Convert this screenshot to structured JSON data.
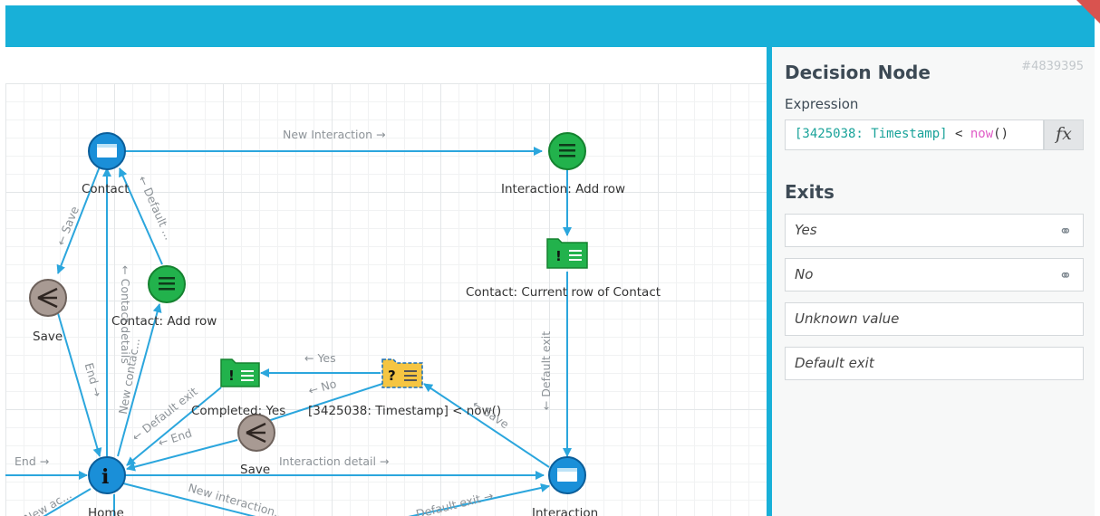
{
  "diagram": {
    "nodes": {
      "contact": "Contact",
      "interaction_add_row": "Interaction: Add row",
      "contact_current_row": "Contact: Current row of Contact",
      "save_left": "Save",
      "contact_add_row": "Contact: Add row",
      "completed_yes": "Completed: Yes",
      "decision_expr": "[3425038: Timestamp] < now()",
      "save_middle": "Save",
      "home": "Home",
      "interaction": "Interaction"
    },
    "edges": {
      "new_interaction": "New Interaction →",
      "save_contact": "← Save",
      "default_contact": "← Default ...",
      "contact_details": "← Contact details",
      "new_contact": "New contac...",
      "end_save": "End →",
      "end_left": "End →",
      "default_exit_completed": "← Default exit",
      "end_save_middle": "← End",
      "yes": "← Yes",
      "no": "← No",
      "save_interaction": "← Save",
      "default_exit_vertical": "← Default exit",
      "interaction_detail": "Interaction detail →",
      "new_interaction_bottom": "New interaction...",
      "default_exit_bottom": "Default exit →",
      "bottom_left_cut": "New ac..."
    }
  },
  "panel": {
    "title": "Decision Node",
    "id": "#4839395",
    "expression_label": "Expression",
    "expression": {
      "ref": "[3425038: Timestamp]",
      "op": " < ",
      "fn": "now",
      "tail": "()"
    },
    "fx_label": "fx",
    "exits_title": "Exits",
    "exits": [
      "Yes",
      "No",
      "Unknown value",
      "Default exit"
    ],
    "link_icon_glyph": "⚭"
  },
  "colors": {
    "accent": "#18b0d8",
    "edge": "#2ba6dd",
    "node_blue": "#1a8fd8",
    "node_green": "#22b24c",
    "node_brown": "#a89a93",
    "node_yellow": "#f5c542"
  }
}
